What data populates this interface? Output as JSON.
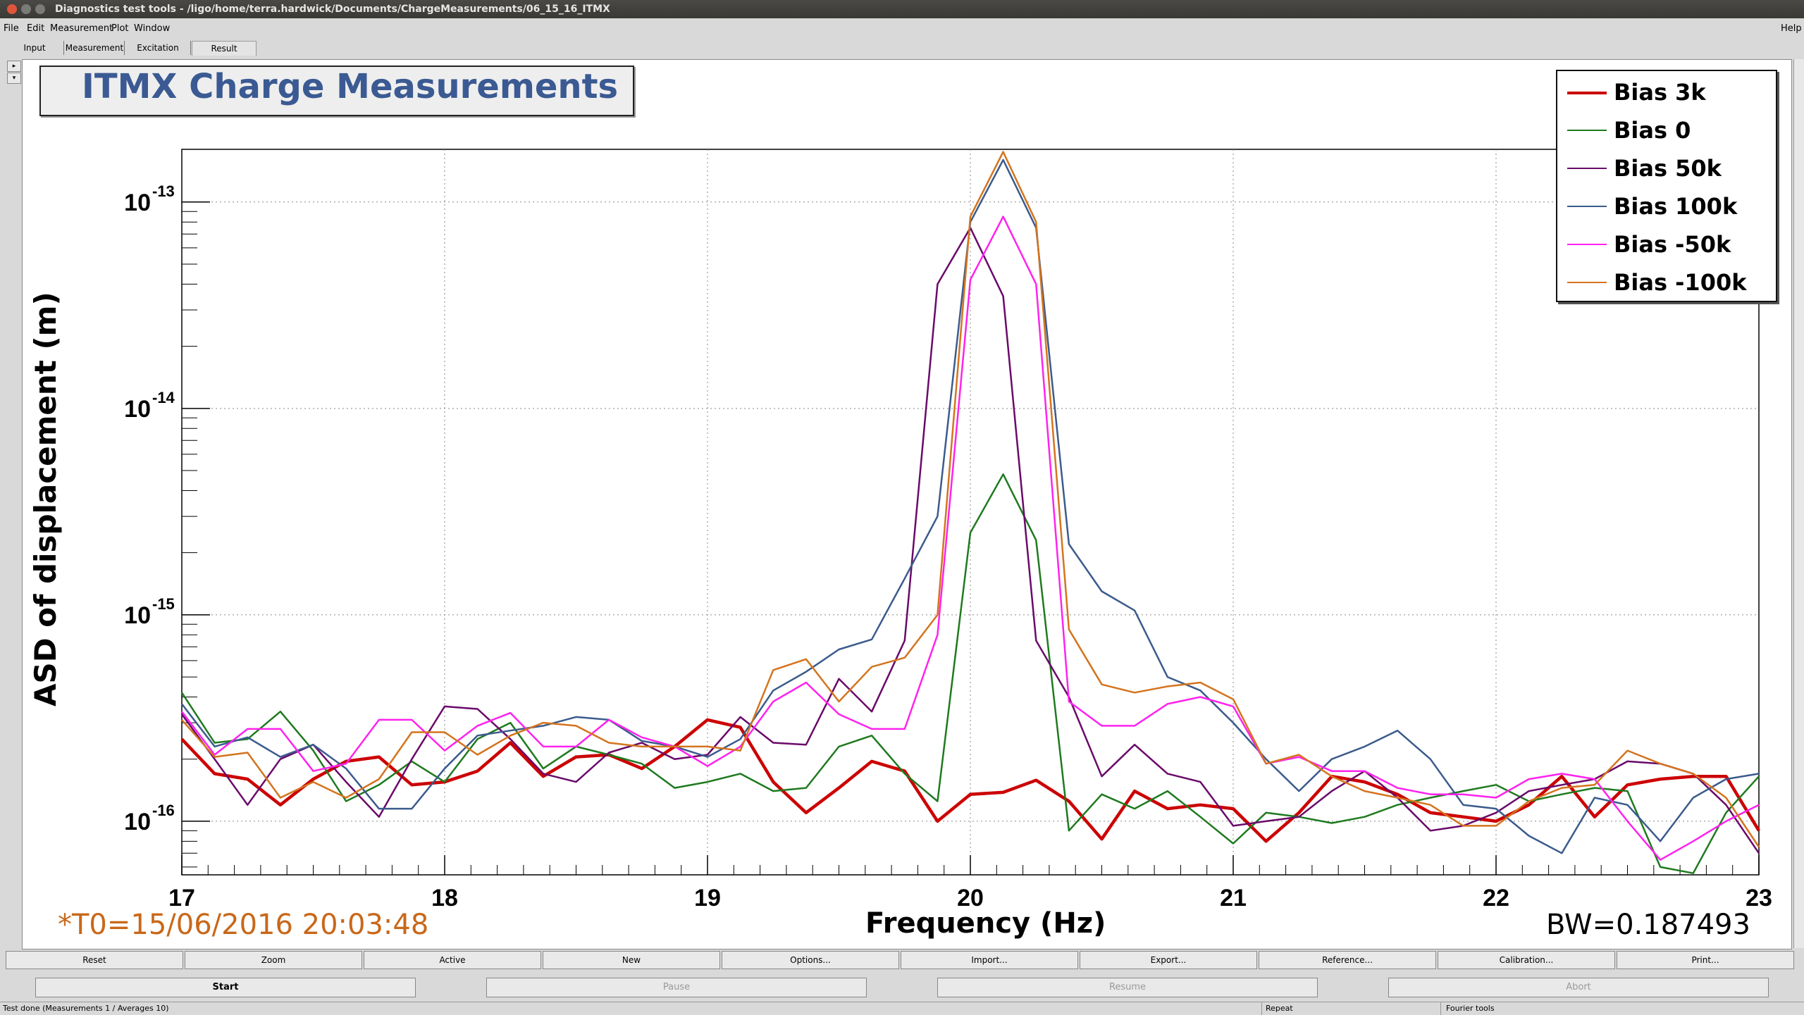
{
  "window": {
    "title": "Diagnostics test tools - /ligo/home/terra.hardwick/Documents/ChargeMeasurements/06_15_16_ITMX"
  },
  "menu": {
    "file": "File",
    "edit": "Edit",
    "measurement": "Measurement",
    "plot": "Plot",
    "window": "Window",
    "help": "Help"
  },
  "tabs": {
    "input": "Input",
    "measurement": "Measurement",
    "excitation": "Excitation",
    "result": "Result"
  },
  "plot_title": "ITMX Charge Measurements",
  "annotations": {
    "t0": "*T0=15/06/2016 20:03:48",
    "bw": "BW=0.187493"
  },
  "chart_data": {
    "type": "line",
    "title": "ITMX Charge Measurements",
    "xlabel": "Frequency (Hz)",
    "ylabel": "ASD of displacement (m)",
    "xlim": [
      17,
      23
    ],
    "ylim": [
      5.5e-17,
      1.8e-13
    ],
    "yscale": "log",
    "grid": true,
    "legend_position": "top-right",
    "x_ticks": [
      "17",
      "18",
      "19",
      "20",
      "21",
      "22",
      "23"
    ],
    "y_ticks": [
      {
        "value": 1e-16,
        "base": "10",
        "exp": "-16"
      },
      {
        "value": 1e-15,
        "base": "10",
        "exp": "-15"
      },
      {
        "value": 1e-14,
        "base": "10",
        "exp": "-14"
      },
      {
        "value": 1e-13,
        "base": "10",
        "exp": "-13"
      }
    ],
    "x": [
      17.0,
      17.125,
      17.25,
      17.375,
      17.5,
      17.625,
      17.75,
      17.875,
      18.0,
      18.125,
      18.25,
      18.375,
      18.5,
      18.625,
      18.75,
      18.875,
      19.0,
      19.125,
      19.25,
      19.375,
      19.5,
      19.625,
      19.75,
      19.875,
      20.0,
      20.125,
      20.25,
      20.375,
      20.5,
      20.625,
      20.75,
      20.875,
      21.0,
      21.125,
      21.25,
      21.375,
      21.5,
      21.625,
      21.75,
      21.875,
      22.0,
      22.125,
      22.25,
      22.375,
      22.5,
      22.625,
      22.75,
      22.875,
      23.0
    ],
    "series": [
      {
        "name": "Bias 3k",
        "color": "#cc0000",
        "width": 4.5,
        "values": [
          2.5e-16,
          1.7e-16,
          1.6e-16,
          1.2e-16,
          1.6e-16,
          1.95e-16,
          2.05e-16,
          1.5e-16,
          1.55e-16,
          1.75e-16,
          2.4e-16,
          1.65e-16,
          2.05e-16,
          2.1e-16,
          1.8e-16,
          2.3e-16,
          3.1e-16,
          2.85e-16,
          1.55e-16,
          1.1e-16,
          1.45e-16,
          1.95e-16,
          1.75e-16,
          1e-16,
          1.35e-16,
          1.38e-16,
          1.58e-16,
          1.25e-16,
          8.2e-17,
          1.4e-16,
          1.15e-16,
          1.2e-16,
          1.15e-16,
          8e-17,
          1.1e-16,
          1.65e-16,
          1.55e-16,
          1.35e-16,
          1.1e-16,
          1.05e-16,
          1e-16,
          1.2e-16,
          1.65e-16,
          1.05e-16,
          1.5e-16,
          1.6e-16,
          1.65e-16,
          1.65e-16,
          9e-17
        ]
      },
      {
        "name": "Bias 0",
        "color": "#1f7a1f",
        "width": 2.5,
        "values": [
          4.2e-16,
          2.4e-16,
          2.5e-16,
          3.4e-16,
          2.2e-16,
          1.25e-16,
          1.5e-16,
          1.95e-16,
          1.55e-16,
          2.5e-16,
          3e-16,
          1.8e-16,
          2.3e-16,
          2.1e-16,
          1.9e-16,
          1.45e-16,
          1.55e-16,
          1.7e-16,
          1.4e-16,
          1.45e-16,
          2.3e-16,
          2.6e-16,
          1.7e-16,
          1.25e-16,
          2.5e-15,
          4.8e-15,
          2.3e-15,
          9e-17,
          1.35e-16,
          1.15e-16,
          1.4e-16,
          1.05e-16,
          7.8e-17,
          1.1e-16,
          1.05e-16,
          9.8e-17,
          1.05e-16,
          1.2e-16,
          1.3e-16,
          1.4e-16,
          1.5e-16,
          1.25e-16,
          1.35e-16,
          1.45e-16,
          1.4e-16,
          6e-17,
          5.6e-17,
          1.1e-16,
          1.65e-16
        ]
      },
      {
        "name": "Bias 50k",
        "color": "#6a0a6a",
        "width": 2.5,
        "values": [
          3.3e-16,
          2e-16,
          1.2e-16,
          2e-16,
          2.35e-16,
          1.55e-16,
          1.05e-16,
          2e-16,
          3.6e-16,
          3.5e-16,
          2.5e-16,
          1.7e-16,
          1.55e-16,
          2.15e-16,
          2.4e-16,
          2e-16,
          2.1e-16,
          3.2e-16,
          2.4e-16,
          2.35e-16,
          4.9e-16,
          3.4e-16,
          7.5e-16,
          4e-14,
          7.5e-14,
          3.5e-14,
          7.5e-16,
          4e-16,
          1.65e-16,
          2.35e-16,
          1.7e-16,
          1.55e-16,
          9.5e-17,
          1e-16,
          1.05e-16,
          1.4e-16,
          1.75e-16,
          1.3e-16,
          9e-17,
          9.5e-17,
          1.1e-16,
          1.4e-16,
          1.5e-16,
          1.6e-16,
          1.95e-16,
          1.9e-16,
          1.7e-16,
          1.2e-16,
          7e-17
        ]
      },
      {
        "name": "Bias 100k",
        "color": "#3b5b8c",
        "width": 2.5,
        "values": [
          3.7e-16,
          2.3e-16,
          2.55e-16,
          2.05e-16,
          2.35e-16,
          1.8e-16,
          1.15e-16,
          1.15e-16,
          1.8e-16,
          2.6e-16,
          2.75e-16,
          2.9e-16,
          3.2e-16,
          3.1e-16,
          2.45e-16,
          2.3e-16,
          2.05e-16,
          2.5e-16,
          4.3e-16,
          5.3e-16,
          6.8e-16,
          7.6e-16,
          1.5e-15,
          3e-15,
          8e-14,
          1.6e-13,
          7.5e-14,
          2.2e-15,
          1.3e-15,
          1.05e-15,
          5e-16,
          4.3e-16,
          3e-16,
          2e-16,
          1.4e-16,
          2e-16,
          2.3e-16,
          2.75e-16,
          2e-16,
          1.2e-16,
          1.15e-16,
          8.5e-17,
          7e-17,
          1.3e-16,
          1.2e-16,
          8e-17,
          1.3e-16,
          1.6e-16,
          1.7e-16
        ]
      },
      {
        "name": "Bias -50k",
        "color": "#ff22ee",
        "width": 2.5,
        "values": [
          3.4e-16,
          2.1e-16,
          2.8e-16,
          2.8e-16,
          1.75e-16,
          1.9e-16,
          3.1e-16,
          3.1e-16,
          2.2e-16,
          2.9e-16,
          3.35e-16,
          2.3e-16,
          2.3e-16,
          3.1e-16,
          2.55e-16,
          2.3e-16,
          1.85e-16,
          2.3e-16,
          3.8e-16,
          4.7e-16,
          3.3e-16,
          2.8e-16,
          2.8e-16,
          8e-16,
          4.2e-14,
          8.5e-14,
          4e-14,
          3.8e-16,
          2.9e-16,
          2.9e-16,
          3.7e-16,
          4e-16,
          3.6e-16,
          1.9e-16,
          2.05e-16,
          1.75e-16,
          1.75e-16,
          1.45e-16,
          1.35e-16,
          1.35e-16,
          1.3e-16,
          1.6e-16,
          1.7e-16,
          1.6e-16,
          1e-16,
          6.5e-17,
          8e-17,
          1e-16,
          1.2e-16
        ]
      },
      {
        "name": "Bias -100k",
        "color": "#d4741e",
        "width": 2.5,
        "values": [
          3.1e-16,
          2.05e-16,
          2.15e-16,
          1.3e-16,
          1.55e-16,
          1.3e-16,
          1.6e-16,
          2.7e-16,
          2.7e-16,
          2.1e-16,
          2.6e-16,
          3e-16,
          2.9e-16,
          2.4e-16,
          2.3e-16,
          2.3e-16,
          2.3e-16,
          2.2e-16,
          5.4e-16,
          6.1e-16,
          3.8e-16,
          5.6e-16,
          6.2e-16,
          1e-15,
          8.5e-14,
          1.75e-13,
          8e-14,
          8.5e-16,
          4.6e-16,
          4.2e-16,
          4.5e-16,
          4.7e-16,
          3.9e-16,
          1.9e-16,
          2.1e-16,
          1.65e-16,
          1.4e-16,
          1.3e-16,
          1.2e-16,
          9.5e-17,
          9.5e-17,
          1.25e-16,
          1.45e-16,
          1.5e-16,
          2.2e-16,
          1.9e-16,
          1.7e-16,
          1.3e-16,
          7.5e-17
        ]
      }
    ]
  },
  "buttons": {
    "reset": "Reset",
    "zoom": "Zoom",
    "active": "Active",
    "new": "New",
    "options": "Options...",
    "import": "Import...",
    "export": "Export...",
    "reference": "Reference...",
    "calibration": "Calibration...",
    "print": "Print..."
  },
  "controls": {
    "start": "Start",
    "pause": "Pause",
    "resume": "Resume",
    "abort": "Abort"
  },
  "status": {
    "message": "Test done (Measurements 1 / Averages 10)",
    "repeat": "Repeat",
    "fourier": "Fourier tools"
  }
}
